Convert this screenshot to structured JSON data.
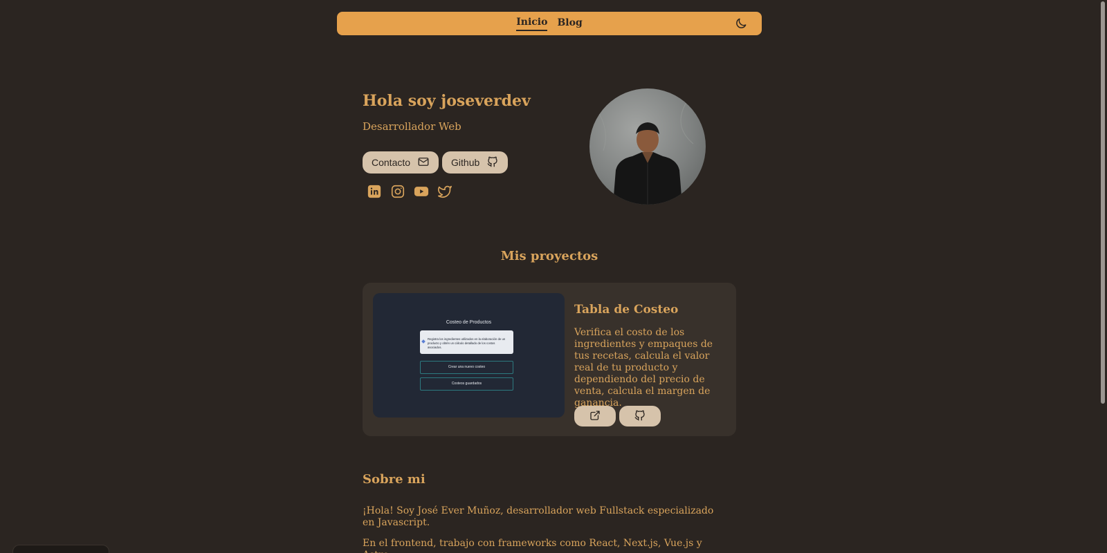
{
  "nav": {
    "links": [
      "Inicio",
      "Blog"
    ],
    "active": "Inicio",
    "theme_icon": "moon-icon"
  },
  "hero": {
    "title": "Hola soy joseverdev",
    "subtitle": "Desarrollador Web",
    "buttons": [
      {
        "label": "Contacto",
        "icon": "mail-icon"
      },
      {
        "label": "Github",
        "icon": "github-icon"
      }
    ],
    "social": [
      "linkedin-icon",
      "instagram-icon",
      "youtube-icon",
      "twitter-icon"
    ]
  },
  "projects": {
    "title": "Mis proyectos",
    "items": [
      {
        "name": "Tabla de Costeo",
        "description": "Verifica el costo de los ingredientes y empaques de tus recetas, calcula el valor real de tu producto y dependiendo del precio de venta, calcula el margen de ganancia.",
        "preview": {
          "title": "Costeo de Productos",
          "info": "Registra los ingredientes utilizados en la elaboración de un producto y obtén un cálculo detallado de los costos asociados.",
          "buttons": [
            "Crear una nuevo costeo",
            "Costeos guardados"
          ]
        },
        "actions": [
          "external-link-icon",
          "github-icon"
        ]
      }
    ]
  },
  "about": {
    "title": "Sobre mi",
    "paragraphs": [
      "¡Hola! Soy José Ever Muñoz, desarrollador web Fullstack especializado en Javascript.",
      "En el frontend, trabajo con frameworks como React, Next.js, Vue.js y Astro,"
    ]
  },
  "colors": {
    "background": "#2b2521",
    "accent": "#e6a14c",
    "text": "#d9a45c",
    "button": "#d6c3ab",
    "card": "#38312b"
  }
}
